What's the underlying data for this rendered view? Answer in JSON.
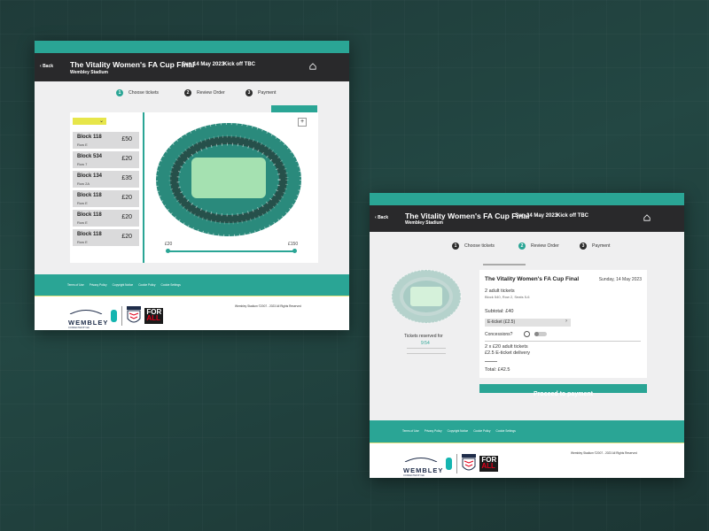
{
  "header": {
    "back_label": "Back",
    "title": "The Vitality Women's FA Cup Final",
    "venue": "Wembley Stadium",
    "date": "Sun 14 May 2023",
    "kickoff": "Kick off TBC"
  },
  "steps": [
    {
      "num": "1",
      "label": "Choose tickets"
    },
    {
      "num": "2",
      "label": "Review Order"
    },
    {
      "num": "3",
      "label": "Payment"
    }
  ],
  "left": {
    "filter_label": "",
    "hospitality_link": "",
    "blocks": [
      {
        "name": "Block 118",
        "row": "Row E",
        "price": "£50"
      },
      {
        "name": "Block 534",
        "row": "Row 7",
        "price": "£20"
      },
      {
        "name": "Block 134",
        "row": "Row 2A",
        "price": "£35"
      },
      {
        "name": "Block 118",
        "row": "Row E",
        "price": "£20"
      },
      {
        "name": "Block 118",
        "row": "Row E",
        "price": "£20"
      },
      {
        "name": "Block 118",
        "row": "Row E",
        "price": "£20"
      }
    ],
    "price_min": "£20",
    "price_max": "£150"
  },
  "right": {
    "back_link": "",
    "reserved_label": "Tickets reserved for",
    "reserved_time": "9:54",
    "reserved_note": "",
    "order": {
      "event": "The Vitality Women's FA Cup Final",
      "date": "Sunday, 14 May 2023",
      "tickets": "2 adult tickets",
      "seats": "Block 540, Row 2, Seats 5-6",
      "subtotal": "Subtotal: £40",
      "delivery": "E-ticket (£2.5)",
      "concessions": "Concessions?",
      "line1": "2 x £20 adult tickets",
      "line2": "£2.5 E-ticket delivery",
      "total": "Total: £42.5"
    },
    "proceed_label": "Proceed to payment"
  },
  "footer": {
    "links": [
      "Terms of Use",
      "Privacy Policy",
      "Copyright Notice",
      "Cookie Policy",
      "Cookie Settings"
    ],
    "copyright": "Wembley Stadium ©2007 - 2023 All Rights Reserved",
    "wembley": "WEMBLEY",
    "connected": "CONNECTED BY EE",
    "for": "FOR",
    "all": "ALL"
  },
  "colors": {
    "teal": "#2aa595",
    "dark": "#29292b",
    "seats": "#2a8a7c",
    "pitch": "#a5e1b1"
  }
}
